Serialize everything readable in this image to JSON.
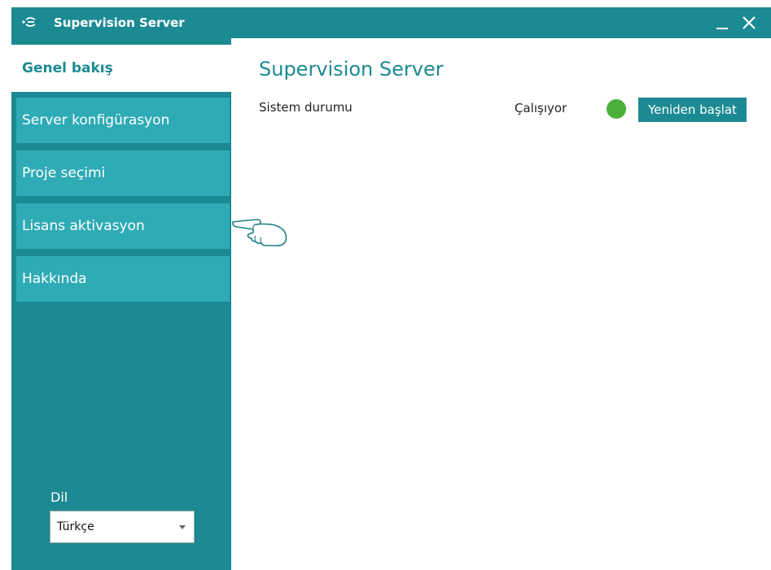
{
  "window": {
    "title": "Supervision Server",
    "icon": "supervision-logo-icon",
    "minimize_icon": "minimize-icon",
    "close_icon": "close-icon"
  },
  "sidebar": {
    "items": [
      {
        "label": "Genel bakış",
        "active": true
      },
      {
        "label": "Server konfigürasyon",
        "active": false
      },
      {
        "label": "Proje seçimi",
        "active": false
      },
      {
        "label": "Lisans aktivasyon",
        "active": false
      },
      {
        "label": "Hakkında",
        "active": false
      }
    ],
    "language": {
      "label": "Dil",
      "selected": "Türkçe"
    }
  },
  "main": {
    "title": "Supervision Server",
    "status": {
      "label": "Sistem durumu",
      "value": "Çalışıyor",
      "indicator_color": "#4caf3c"
    },
    "restart_label": "Yeniden başlat"
  },
  "colors": {
    "accent": "#1c8a93",
    "nav_item": "#2fabb6",
    "status_ok": "#4caf3c"
  },
  "cursor": {
    "icon": "pointing-hand-cursor-icon"
  }
}
